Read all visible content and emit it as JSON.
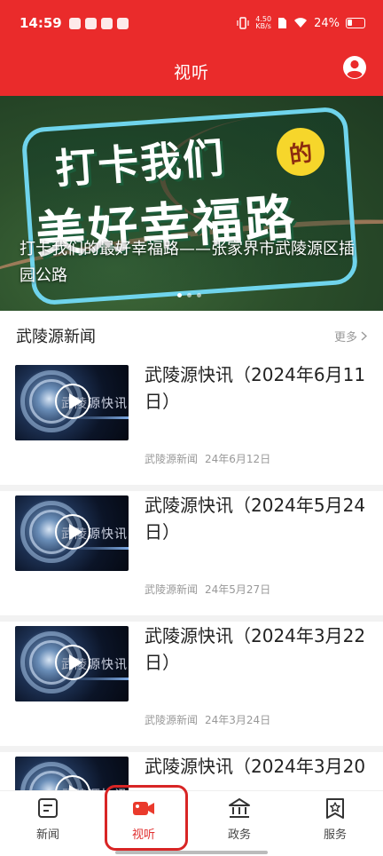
{
  "status_bar": {
    "time": "14:59",
    "net_speed_top": "4.50",
    "net_speed_bottom": "KB/s",
    "battery": "24%"
  },
  "header": {
    "title": "视听",
    "user_icon": "user-avatar-icon"
  },
  "banner": {
    "slogan_line1": "打卡我们",
    "slogan_badge": "的",
    "slogan_line2": "美好幸福路",
    "caption": "打卡我们的最好幸福路——张家界市武陵源区插园公路",
    "pages": 3,
    "active_page": 1
  },
  "news_section": {
    "title": "武陵源新闻",
    "more_label": "更多",
    "thumb_text": "武陵源快讯",
    "items": [
      {
        "title": "武陵源快讯（2024年6月11日）",
        "source": "武陵源新闻",
        "date": "24年6月12日"
      },
      {
        "title": "武陵源快讯（2024年5月24日）",
        "source": "武陵源新闻",
        "date": "24年5月27日"
      },
      {
        "title": "武陵源快讯（2024年3月22日）",
        "source": "武陵源新闻",
        "date": "24年3月24日"
      },
      {
        "title": "武陵源快讯（2024年3月20",
        "source": "",
        "date": ""
      }
    ]
  },
  "bottom_nav": {
    "tabs": [
      {
        "label": "新闻",
        "icon": "news-icon"
      },
      {
        "label": "视听",
        "icon": "video-camera-icon"
      },
      {
        "label": "政务",
        "icon": "government-building-icon"
      },
      {
        "label": "服务",
        "icon": "service-star-icon"
      }
    ],
    "active": 1
  },
  "colors": {
    "brand_red": "#ea2b2b",
    "highlight_border": "#d82525"
  }
}
